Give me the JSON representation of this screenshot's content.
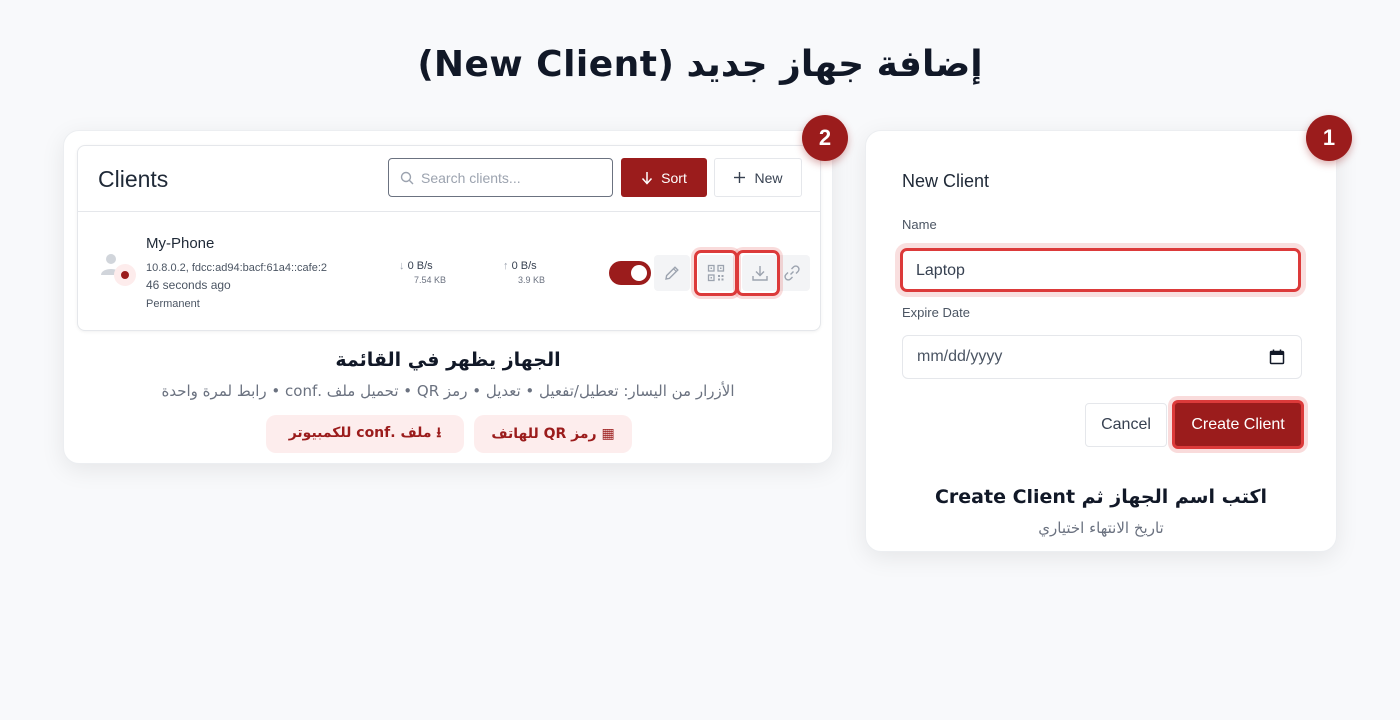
{
  "page": {
    "title": "إضافة جهاز جديد (New Client)"
  },
  "step2": {
    "badge": "2",
    "panel": {
      "title": "Clients",
      "search_placeholder": "Search clients...",
      "sort_label": "Sort",
      "new_label": "New"
    },
    "client": {
      "name": "My-Phone",
      "address": "10.8.0.2, fdcc:ad94:bacf:61a4::cafe:2",
      "last_seen": "46 seconds ago",
      "expiry": "Permanent",
      "download_rate": "0 B/s",
      "download_total": "7.54 KB",
      "upload_rate": "0 B/s",
      "upload_total": "3.9 KB",
      "enabled": true
    },
    "caption_title": "الجهاز يظهر في القائمة",
    "caption_sub": "الأزرار من اليسار: تعطيل/تفعيل • تعديل • رمز QR • تحميل ملف .conf • رابط لمرة واحدة",
    "chips": {
      "qr": "▦ رمز QR للهاتف",
      "conf": "⭳ ملف .conf للكمبيوتر"
    }
  },
  "step1": {
    "badge": "1",
    "form_title": "New Client",
    "name_label": "Name",
    "name_value": "Laptop",
    "expire_label": "Expire Date",
    "expire_placeholder": "mm/dd/yyyy",
    "cancel_label": "Cancel",
    "create_label": "Create Client",
    "caption_title": "اكتب اسم الجهاز ثم Create Client",
    "caption_sub": "تاريخ الانتهاء اختياري"
  },
  "colors": {
    "brand": "#9b1c1c",
    "highlight": "#dc3a3a",
    "chip_bg": "#fdeded"
  }
}
